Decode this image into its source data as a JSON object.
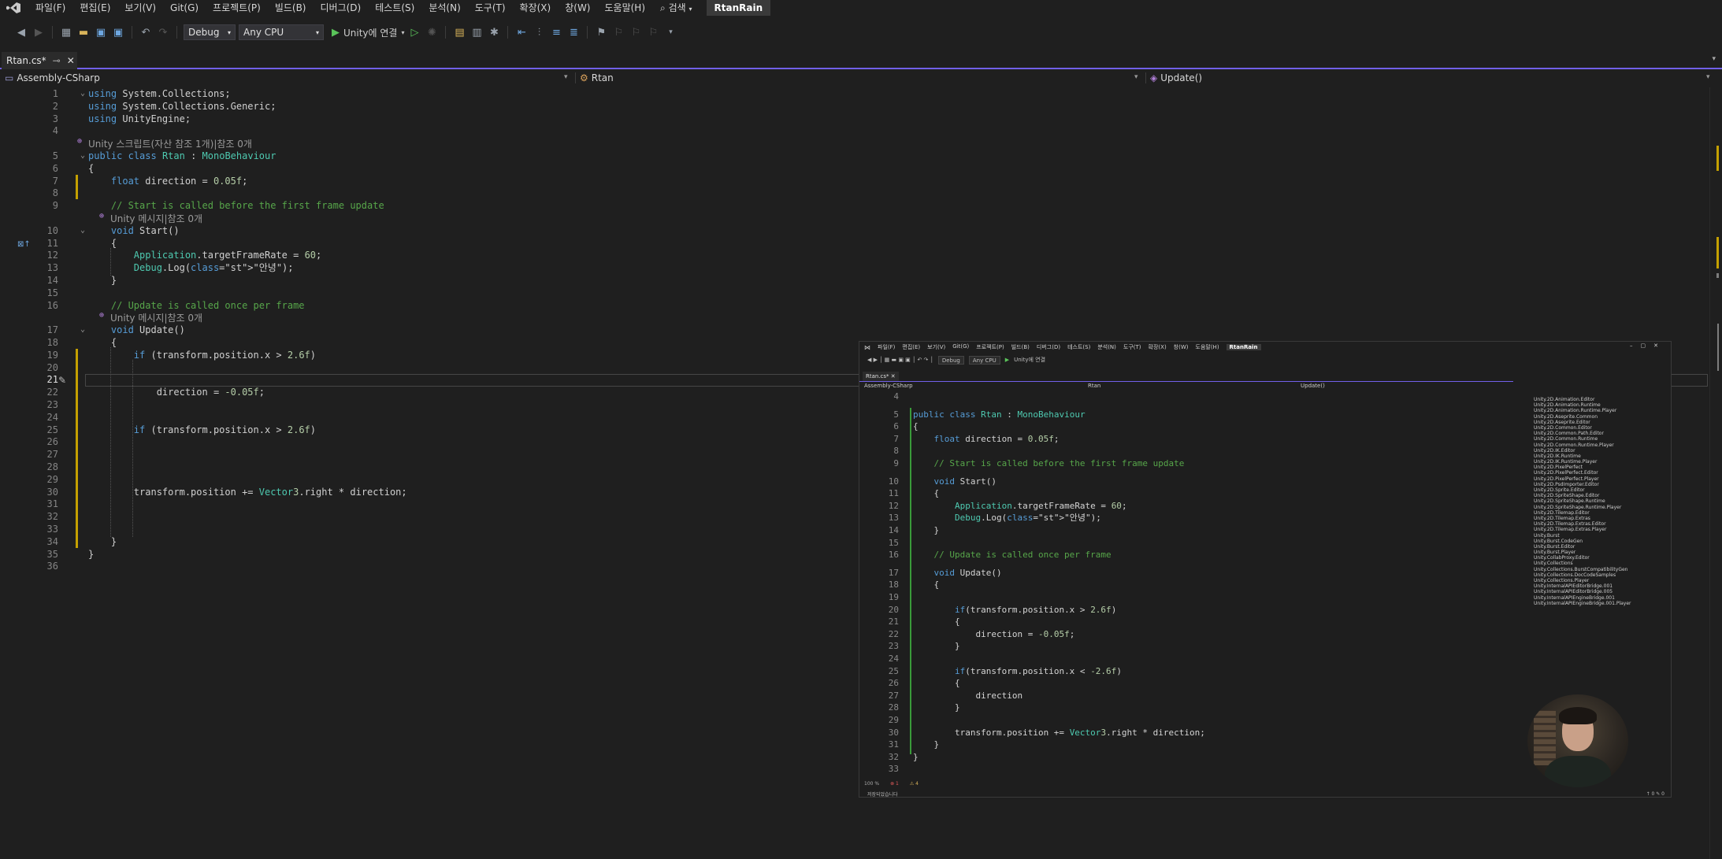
{
  "menubar": {
    "items": [
      "파일(F)",
      "편집(E)",
      "보기(V)",
      "Git(G)",
      "프로젝트(P)",
      "빌드(B)",
      "디버그(D)",
      "테스트(S)",
      "분석(N)",
      "도구(T)",
      "확장(X)",
      "창(W)",
      "도움말(H)"
    ],
    "search_label": "검색",
    "solution_name": "RtanRain"
  },
  "toolbar": {
    "config": "Debug",
    "platform": "Any CPU",
    "run_label": "Unity에 연결"
  },
  "tab": {
    "title": "Rtan.cs*"
  },
  "navbar": {
    "project": "Assembly-CSharp",
    "class": "Rtan",
    "member": "Update()"
  },
  "hints": {
    "class_ref": "Unity 스크립트(자산 참조 1개)|참조 0개",
    "start_ref": "Unity 메시지|참조 0개",
    "update_ref": "Unity 메시지|참조 0개"
  },
  "code_lines": [
    {
      "n": "1",
      "t": "using System.Collections;"
    },
    {
      "n": "2",
      "t": "using System.Collections.Generic;"
    },
    {
      "n": "3",
      "t": "using UnityEngine;"
    },
    {
      "n": "4",
      "t": ""
    },
    {
      "n": "5",
      "t": "public class Rtan : MonoBehaviour"
    },
    {
      "n": "6",
      "t": "{"
    },
    {
      "n": "7",
      "t": "    float direction = 0.05f;"
    },
    {
      "n": "8",
      "t": ""
    },
    {
      "n": "9",
      "t": "    // Start is called before the first frame update"
    },
    {
      "n": "10",
      "t": "    void Start()"
    },
    {
      "n": "11",
      "t": "    {"
    },
    {
      "n": "12",
      "t": "        Application.targetFrameRate = 60;"
    },
    {
      "n": "13",
      "t": "        Debug.Log(\"안녕\");"
    },
    {
      "n": "14",
      "t": "    }"
    },
    {
      "n": "15",
      "t": ""
    },
    {
      "n": "16",
      "t": "    // Update is called once per frame"
    },
    {
      "n": "17",
      "t": "    void Update()"
    },
    {
      "n": "18",
      "t": "    {"
    },
    {
      "n": "19",
      "t": "        if (transform.position.x > 2.6f)"
    },
    {
      "n": "20",
      "t": ""
    },
    {
      "n": "21",
      "t": ""
    },
    {
      "n": "22",
      "t": "            direction = -0.05f;"
    },
    {
      "n": "23",
      "t": ""
    },
    {
      "n": "24",
      "t": ""
    },
    {
      "n": "25",
      "t": "        if (transform.position.x > 2.6f)"
    },
    {
      "n": "26",
      "t": ""
    },
    {
      "n": "27",
      "t": ""
    },
    {
      "n": "28",
      "t": ""
    },
    {
      "n": "29",
      "t": ""
    },
    {
      "n": "30",
      "t": "        transform.position += Vector3.right * direction;"
    },
    {
      "n": "31",
      "t": ""
    },
    {
      "n": "32",
      "t": ""
    },
    {
      "n": "33",
      "t": ""
    },
    {
      "n": "34",
      "t": "    }"
    },
    {
      "n": "35",
      "t": "}"
    },
    {
      "n": "36",
      "t": ""
    }
  ],
  "pip": {
    "solution_name": "RtanRain",
    "tab_title": "Rtan.cs*",
    "nav_project": "Assembly-CSharp",
    "nav_class": "Rtan",
    "nav_member": "Update()",
    "config": "Debug",
    "platform": "Any CPU",
    "run_label": "Unity에 연결",
    "zoom": "100 %",
    "status_ready": "저장되었습니다",
    "code_lines": [
      {
        "n": "4",
        "t": ""
      },
      {
        "n": "5",
        "t": "public class Rtan : MonoBehaviour"
      },
      {
        "n": "6",
        "t": "{"
      },
      {
        "n": "7",
        "t": "    float direction = 0.05f;"
      },
      {
        "n": "8",
        "t": ""
      },
      {
        "n": "9",
        "t": "    // Start is called before the first frame update"
      },
      {
        "n": "10",
        "t": "    void Start()"
      },
      {
        "n": "11",
        "t": "    {"
      },
      {
        "n": "12",
        "t": "        Application.targetFrameRate = 60;"
      },
      {
        "n": "13",
        "t": "        Debug.Log(\"안녕\");"
      },
      {
        "n": "14",
        "t": "    }"
      },
      {
        "n": "15",
        "t": ""
      },
      {
        "n": "16",
        "t": "    // Update is called once per frame"
      },
      {
        "n": "17",
        "t": "    void Update()"
      },
      {
        "n": "18",
        "t": "    {"
      },
      {
        "n": "19",
        "t": ""
      },
      {
        "n": "20",
        "t": "        if(transform.position.x > 2.6f)"
      },
      {
        "n": "21",
        "t": "        {"
      },
      {
        "n": "22",
        "t": "            direction = -0.05f;"
      },
      {
        "n": "23",
        "t": "        }"
      },
      {
        "n": "24",
        "t": ""
      },
      {
        "n": "25",
        "t": "        if(transform.position.x < -2.6f)"
      },
      {
        "n": "26",
        "t": "        {"
      },
      {
        "n": "27",
        "t": "            direction"
      },
      {
        "n": "28",
        "t": "        }"
      },
      {
        "n": "29",
        "t": ""
      },
      {
        "n": "30",
        "t": "        transform.position += Vector3.right * direction;"
      },
      {
        "n": "31",
        "t": "    }"
      },
      {
        "n": "32",
        "t": "}"
      },
      {
        "n": "33",
        "t": ""
      }
    ],
    "solution_items": [
      "Unity.2D.Animation.Editor",
      "Unity.2D.Animation.Runtime",
      "Unity.2D.Animation.Runtime.Player",
      "Unity.2D.Aseprite.Common",
      "Unity.2D.Aseprite.Editor",
      "Unity.2D.Common.Editor",
      "Unity.2D.Common.Path.Editor",
      "Unity.2D.Common.Runtime",
      "Unity.2D.Common.Runtime.Player",
      "Unity.2D.IK.Editor",
      "Unity.2D.IK.Runtime",
      "Unity.2D.IK.Runtime.Player",
      "Unity.2D.PixelPerfect",
      "Unity.2D.PixelPerfect.Editor",
      "Unity.2D.PixelPerfect.Player",
      "Unity.2D.PsdImporter.Editor",
      "Unity.2D.Sprite.Editor",
      "Unity.2D.SpriteShape.Editor",
      "Unity.2D.SpriteShape.Runtime",
      "Unity.2D.SpriteShape.Runtime.Player",
      "Unity.2D.Tilemap.Editor",
      "Unity.2D.Tilemap.Extras",
      "Unity.2D.Tilemap.Extras.Editor",
      "Unity.2D.Tilemap.Extras.Player",
      "Unity.Burst",
      "Unity.Burst.CodeGen",
      "Unity.Burst.Editor",
      "Unity.Burst.Player",
      "Unity.CollabProxy.Editor",
      "Unity.Collections",
      "Unity.Collections.BurstCompatibilityGen",
      "Unity.Collections.DocCodeSamples",
      "Unity.Collections.Player",
      "Unity.InternalAPIEditorBridge.001",
      "Unity.InternalAPIEditorBridge.005",
      "Unity.InternalAPIEngineBridge.001",
      "Unity.InternalAPIEngineBridge.001.Player"
    ]
  }
}
